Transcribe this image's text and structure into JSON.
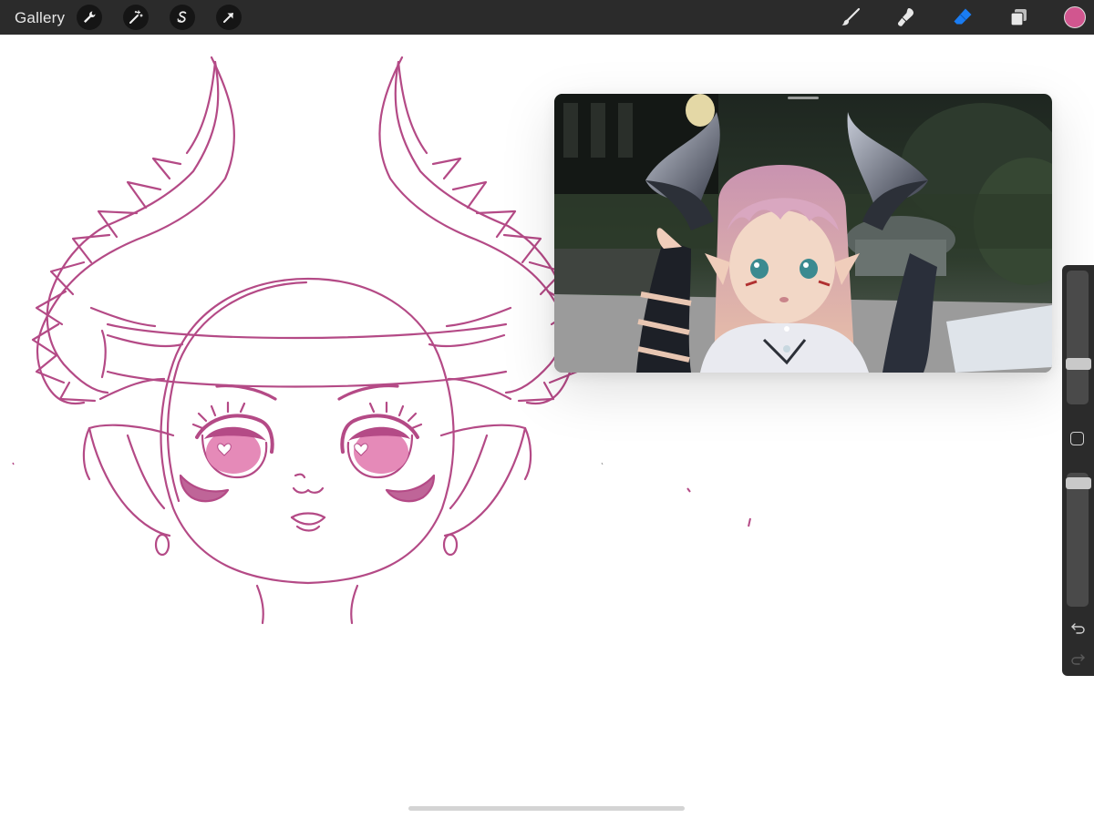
{
  "toolbar": {
    "gallery_label": "Gallery",
    "left_tools": [
      "wrench-icon",
      "magic-wand-icon",
      "selection-s-icon",
      "transform-arrow-icon"
    ],
    "right_tools": [
      "brush-icon",
      "smudge-icon",
      "eraser-icon",
      "layers-icon"
    ],
    "active_tool": "eraser-icon",
    "colors": {
      "bar": "#2b2b2b",
      "active_tool": "#1a7cf2",
      "current_color": "#d1568f"
    }
  },
  "canvas": {
    "sketch_color": "#b44a86",
    "eye_fill": "#e58ab8"
  },
  "reference_window": {
    "visible": true
  },
  "sidebar": {
    "brush_size": 0.28,
    "opacity": 0.96,
    "modify_icon": "square-icon",
    "undo_icon": "undo-icon",
    "redo_icon": "redo-icon"
  }
}
